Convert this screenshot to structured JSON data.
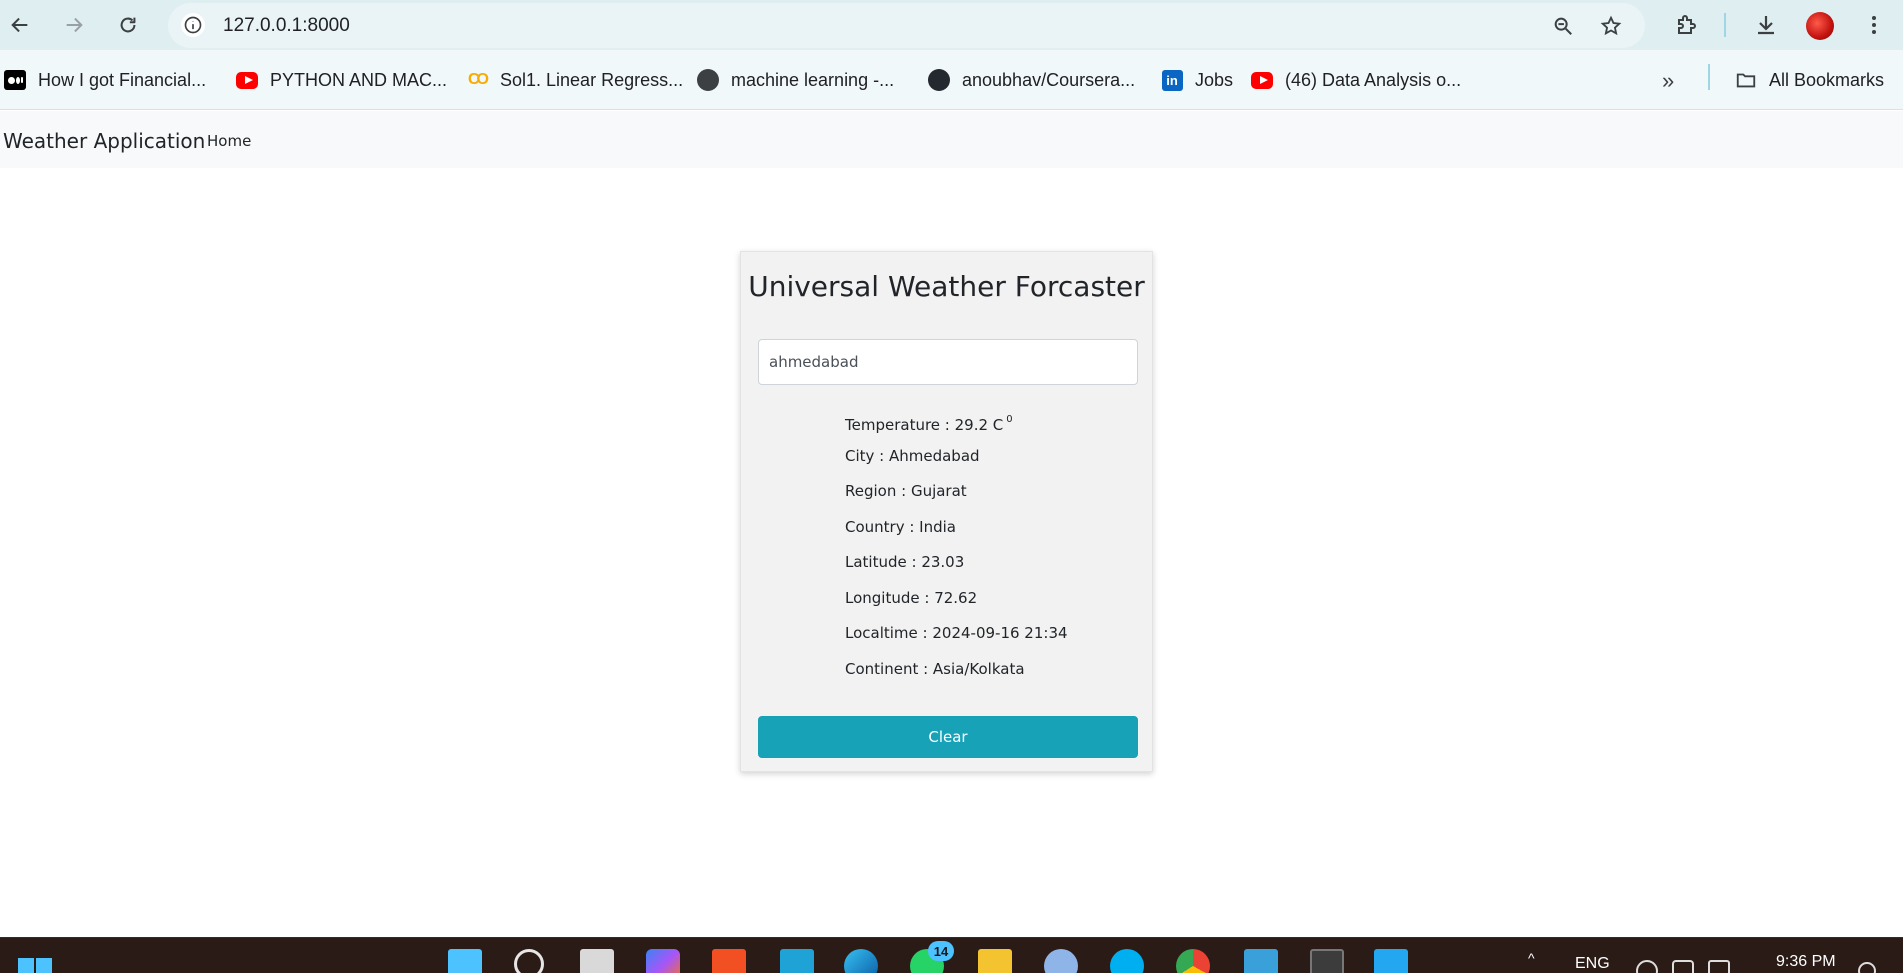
{
  "browser": {
    "url": "127.0.0.1:8000",
    "bookmarks": [
      {
        "label": "How I got Financial...",
        "icon": "medium-icon"
      },
      {
        "label": "PYTHON AND MAC...",
        "icon": "youtube-icon"
      },
      {
        "label": "Sol1. Linear Regress...",
        "icon": "colab-icon"
      },
      {
        "label": "machine learning -...",
        "icon": "globe-icon"
      },
      {
        "label": "anoubhav/Coursera...",
        "icon": "github-icon"
      },
      {
        "label": "Jobs",
        "icon": "linkedin-icon"
      },
      {
        "label": "(46) Data Analysis o...",
        "icon": "youtube-icon"
      }
    ],
    "all_bookmarks_label": "All Bookmarks",
    "overflow_glyph": "»"
  },
  "navbar": {
    "brand": "Weather Application",
    "home_link": "Home"
  },
  "card": {
    "title": "Universal Weather Forcaster",
    "input_value": "ahmedabad",
    "temperature_label": "Temperature : 29.2 C",
    "temperature_sup": "0",
    "city": "City : Ahmedabad",
    "region": "Region : Gujarat",
    "country": "Country : India",
    "latitude": "Latitude : 23.03",
    "longitude": "Longitude : 72.62",
    "localtime": "Localtime : 2024-09-16 21:34",
    "continent": "Continent : Asia/Kolkata",
    "clear_label": "Clear"
  },
  "taskbar": {
    "whatsapp_badge": "14",
    "language": "ENG",
    "time": "9:36 PM"
  },
  "colors": {
    "chrome_bg": "#dfeef1",
    "bookmark_bg": "#f1f8fa",
    "navbar_bg": "#f8f9fa",
    "button_accent": "#17a2b8",
    "taskbar_bg": "#2b1b17"
  }
}
